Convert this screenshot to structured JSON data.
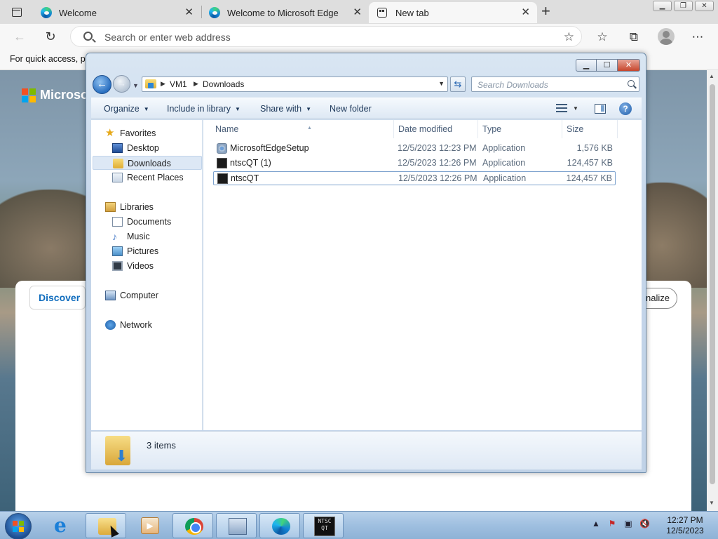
{
  "browser": {
    "tabs": [
      {
        "label": "Welcome",
        "active": false
      },
      {
        "label": "Welcome to Microsoft Edge",
        "active": false
      },
      {
        "label": "New tab",
        "active": true
      }
    ],
    "address_placeholder": "Search or enter web address",
    "favorites_bar_text": "For quick access, pla"
  },
  "newtab_page": {
    "brand": "Microsoft",
    "discover_label": "Discover",
    "personalize_label": "nalize"
  },
  "explorer": {
    "breadcrumb": [
      "VM1",
      "Downloads"
    ],
    "search_placeholder": "Search Downloads",
    "commands": [
      "Organize",
      "Include in library",
      "Share with",
      "New folder"
    ],
    "nav": {
      "favorites": {
        "label": "Favorites",
        "items": [
          "Desktop",
          "Downloads",
          "Recent Places"
        ]
      },
      "libraries": {
        "label": "Libraries",
        "items": [
          "Documents",
          "Music",
          "Pictures",
          "Videos"
        ]
      },
      "computer": "Computer",
      "network": "Network"
    },
    "columns": [
      "Name",
      "Date modified",
      "Type",
      "Size"
    ],
    "files": [
      {
        "name": "MicrosoftEdgeSetup",
        "date": "12/5/2023 12:23 PM",
        "type": "Application",
        "size": "1,576 KB"
      },
      {
        "name": "ntscQT (1)",
        "date": "12/5/2023 12:26 PM",
        "type": "Application",
        "size": "124,457 KB"
      },
      {
        "name": "ntscQT",
        "date": "12/5/2023 12:26 PM",
        "type": "Application",
        "size": "124,457 KB"
      }
    ],
    "item_count": "3 items"
  },
  "taskbar": {
    "clock_time": "12:27 PM",
    "clock_date": "12/5/2023",
    "ntsc_icon_text": "NTSC QT"
  },
  "colors": {
    "edge_accent": "#0f6cbd",
    "explorer_frame": "#c5d6ea",
    "taskbar": "#9fbfe0"
  }
}
